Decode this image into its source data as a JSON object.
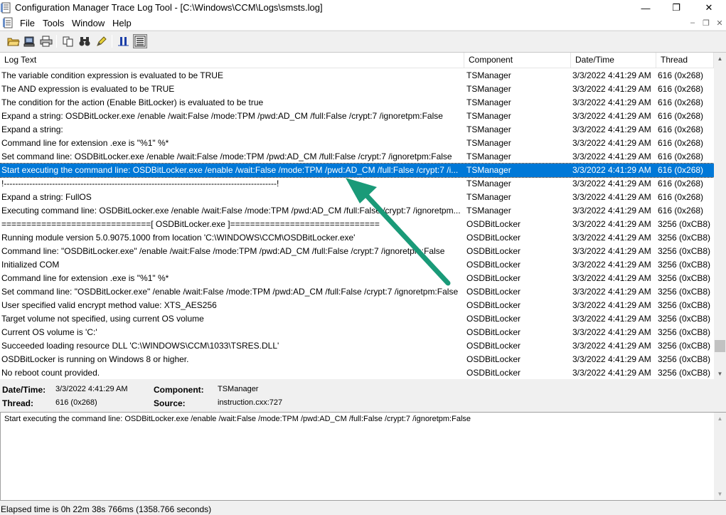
{
  "window": {
    "title": "Configuration Manager Trace Log Tool - [C:\\Windows\\CCM\\Logs\\smsts.log]",
    "minimize_glyph": "—",
    "maximize_glyph": "❐",
    "close_glyph": "✕"
  },
  "menu": {
    "items": [
      "File",
      "Tools",
      "Window",
      "Help"
    ]
  },
  "toolbar": {
    "icons": [
      "open-folder-icon",
      "print-server-icon",
      "print-icon",
      "copy-icon",
      "find-binoculars-icon",
      "highlight-pencil-icon",
      "pause-icon",
      "split-view-icon"
    ]
  },
  "list": {
    "headers": {
      "log_text": "Log Text",
      "component": "Component",
      "date_time": "Date/Time",
      "thread": "Thread"
    },
    "rows": [
      {
        "text": "The variable condition expression is evaluated to be TRUE",
        "component": "TSManager",
        "date": "3/3/2022 4:41:29 AM",
        "thread": "616 (0x268)"
      },
      {
        "text": "The AND expression is evaluated to be TRUE",
        "component": "TSManager",
        "date": "3/3/2022 4:41:29 AM",
        "thread": "616 (0x268)"
      },
      {
        "text": "The condition for the action (Enable BitLocker) is evaluated to be true",
        "component": "TSManager",
        "date": "3/3/2022 4:41:29 AM",
        "thread": "616 (0x268)"
      },
      {
        "text": "Expand a string: OSDBitLocker.exe /enable  /wait:False /mode:TPM /pwd:AD_CM /full:False /crypt:7 /ignoretpm:False",
        "component": "TSManager",
        "date": "3/3/2022 4:41:29 AM",
        "thread": "616 (0x268)"
      },
      {
        "text": "Expand a string:",
        "component": "TSManager",
        "date": "3/3/2022 4:41:29 AM",
        "thread": "616 (0x268)"
      },
      {
        "text": "Command line for extension .exe is \"%1\" %*",
        "component": "TSManager",
        "date": "3/3/2022 4:41:29 AM",
        "thread": "616 (0x268)"
      },
      {
        "text": "Set command line: OSDBitLocker.exe /enable  /wait:False /mode:TPM /pwd:AD_CM /full:False /crypt:7 /ignoretpm:False",
        "component": "TSManager",
        "date": "3/3/2022 4:41:29 AM",
        "thread": "616 (0x268)"
      },
      {
        "text": "Start executing the command line: OSDBitLocker.exe /enable  /wait:False /mode:TPM /pwd:AD_CM /full:False /crypt:7 /i...",
        "component": "TSManager",
        "date": "3/3/2022 4:41:29 AM",
        "thread": "616 (0x268)",
        "selected": true
      },
      {
        "text": "!------------------------------------------------------------------------------------------------!",
        "component": "TSManager",
        "date": "3/3/2022 4:41:29 AM",
        "thread": "616 (0x268)"
      },
      {
        "text": "Expand a string: FullOS",
        "component": "TSManager",
        "date": "3/3/2022 4:41:29 AM",
        "thread": "616 (0x268)"
      },
      {
        "text": "Executing command line: OSDBitLocker.exe /enable  /wait:False /mode:TPM /pwd:AD_CM /full:False /crypt:7 /ignoretpm...",
        "component": "TSManager",
        "date": "3/3/2022 4:41:29 AM",
        "thread": "616 (0x268)"
      },
      {
        "text": "==============================[ OSDBitLocker.exe ]==============================",
        "component": "OSDBitLocker",
        "date": "3/3/2022 4:41:29 AM",
        "thread": "3256 (0xCB8)"
      },
      {
        "text": "Running module version 5.0.9075.1000 from location 'C:\\WINDOWS\\CCM\\OSDBitLocker.exe'",
        "component": "OSDBitLocker",
        "date": "3/3/2022 4:41:29 AM",
        "thread": "3256 (0xCB8)"
      },
      {
        "text": "Command line: \"OSDBitLocker.exe\" /enable /wait:False /mode:TPM /pwd:AD_CM /full:False /crypt:7 /ignoretpm:False",
        "component": "OSDBitLocker",
        "date": "3/3/2022 4:41:29 AM",
        "thread": "3256 (0xCB8)"
      },
      {
        "text": "Initialized COM",
        "component": "OSDBitLocker",
        "date": "3/3/2022 4:41:29 AM",
        "thread": "3256 (0xCB8)"
      },
      {
        "text": "Command line for extension .exe is \"%1\" %*",
        "component": "OSDBitLocker",
        "date": "3/3/2022 4:41:29 AM",
        "thread": "3256 (0xCB8)"
      },
      {
        "text": "Set command line: \"OSDBitLocker.exe\" /enable /wait:False /mode:TPM /pwd:AD_CM /full:False /crypt:7 /ignoretpm:False",
        "component": "OSDBitLocker",
        "date": "3/3/2022 4:41:29 AM",
        "thread": "3256 (0xCB8)"
      },
      {
        "text": "User specified valid encrypt method value: XTS_AES256",
        "component": "OSDBitLocker",
        "date": "3/3/2022 4:41:29 AM",
        "thread": "3256 (0xCB8)"
      },
      {
        "text": "Target volume not specified, using current OS volume",
        "component": "OSDBitLocker",
        "date": "3/3/2022 4:41:29 AM",
        "thread": "3256 (0xCB8)"
      },
      {
        "text": "Current OS volume is 'C:'",
        "component": "OSDBitLocker",
        "date": "3/3/2022 4:41:29 AM",
        "thread": "3256 (0xCB8)"
      },
      {
        "text": "Succeeded loading resource DLL 'C:\\WINDOWS\\CCM\\1033\\TSRES.DLL'",
        "component": "OSDBitLocker",
        "date": "3/3/2022 4:41:29 AM",
        "thread": "3256 (0xCB8)"
      },
      {
        "text": "OSDBitLocker is running on Windows 8 or higher.",
        "component": "OSDBitLocker",
        "date": "3/3/2022 4:41:29 AM",
        "thread": "3256 (0xCB8)"
      },
      {
        "text": "No reboot count provided.",
        "component": "OSDBitLocker",
        "date": "3/3/2022 4:41:29 AM",
        "thread": "3256 (0xCB8)"
      }
    ]
  },
  "details": {
    "date_time_label": "Date/Time:",
    "date_time_value": "3/3/2022 4:41:29 AM",
    "component_label": "Component:",
    "component_value": "TSManager",
    "thread_label": "Thread:",
    "thread_value": "616 (0x268)",
    "source_label": "Source:",
    "source_value": "instruction.cxx:727"
  },
  "message": {
    "text": "Start executing the command line: OSDBitLocker.exe /enable  /wait:False /mode:TPM /pwd:AD_CM /full:False /crypt:7 /ignoretpm:False"
  },
  "status": {
    "text": "Elapsed time is 0h 22m 38s 766ms (1358.766 seconds)"
  },
  "colors": {
    "selection": "#0078d7",
    "annotation_arrow": "#1a9a78"
  }
}
